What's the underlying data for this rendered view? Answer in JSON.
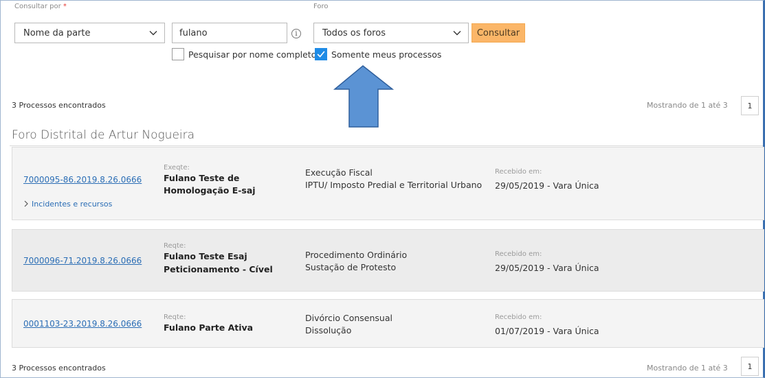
{
  "search": {
    "consultar_por_label": "Consultar por",
    "required_mark": "*",
    "consultar_por_value": "Nome da parte",
    "query_value": "fulano",
    "info_icon_glyph": "i",
    "foro_label": "Foro",
    "foro_value": "Todos os foros",
    "consultar_button": "Consultar",
    "nome_completo_label": "Pesquisar por nome completo",
    "nome_completo_checked": false,
    "meus_processos_label": "Somente meus processos",
    "meus_processos_checked": true
  },
  "results": {
    "found_text": "3 Processos encontrados",
    "showing_text": "Mostrando de 1 até 3",
    "page": "1"
  },
  "foro_group": {
    "title": "Foro Distrital de Artur Nogueira",
    "processes": [
      {
        "number": "7000095-86.2019.8.26.0666",
        "role": "Exeqte:",
        "party_line1": "Fulano Teste de",
        "party_line2": "Homologação E-saj",
        "class": "Execução Fiscal",
        "subject": "IPTU/ Imposto Predial e Territorial Urbano",
        "received_label": "Recebido em:",
        "received_value": "29/05/2019 - Vara Única",
        "incidents_link": "Incidentes e recursos"
      },
      {
        "number": "7000096-71.2019.8.26.0666",
        "role": "Reqte:",
        "party_line1": "Fulano Teste Esaj",
        "party_line2": "Peticionamento - Cível",
        "class": "Procedimento Ordinário",
        "subject": "Sustação de Protesto",
        "received_label": "Recebido em:",
        "received_value": "29/05/2019 - Vara Única"
      },
      {
        "number": "0001103-23.2019.8.26.0666",
        "role": "Reqte:",
        "party_line1": "Fulano Parte Ativa",
        "class": "Divórcio Consensual",
        "subject": "Dissolução",
        "received_label": "Recebido em:",
        "received_value": "01/07/2019 - Vara Única"
      }
    ]
  },
  "colors": {
    "accent_button": "#fbb668",
    "link": "#2a6db5",
    "checkbox_checked": "#1e8be6",
    "annotation_arrow": "#5b93d4"
  },
  "icons": {
    "dropdown": "chevron-down-icon",
    "info": "info-icon",
    "check": "check-icon",
    "expand": "chevron-right-icon",
    "annotation": "up-arrow-annotation-icon"
  }
}
